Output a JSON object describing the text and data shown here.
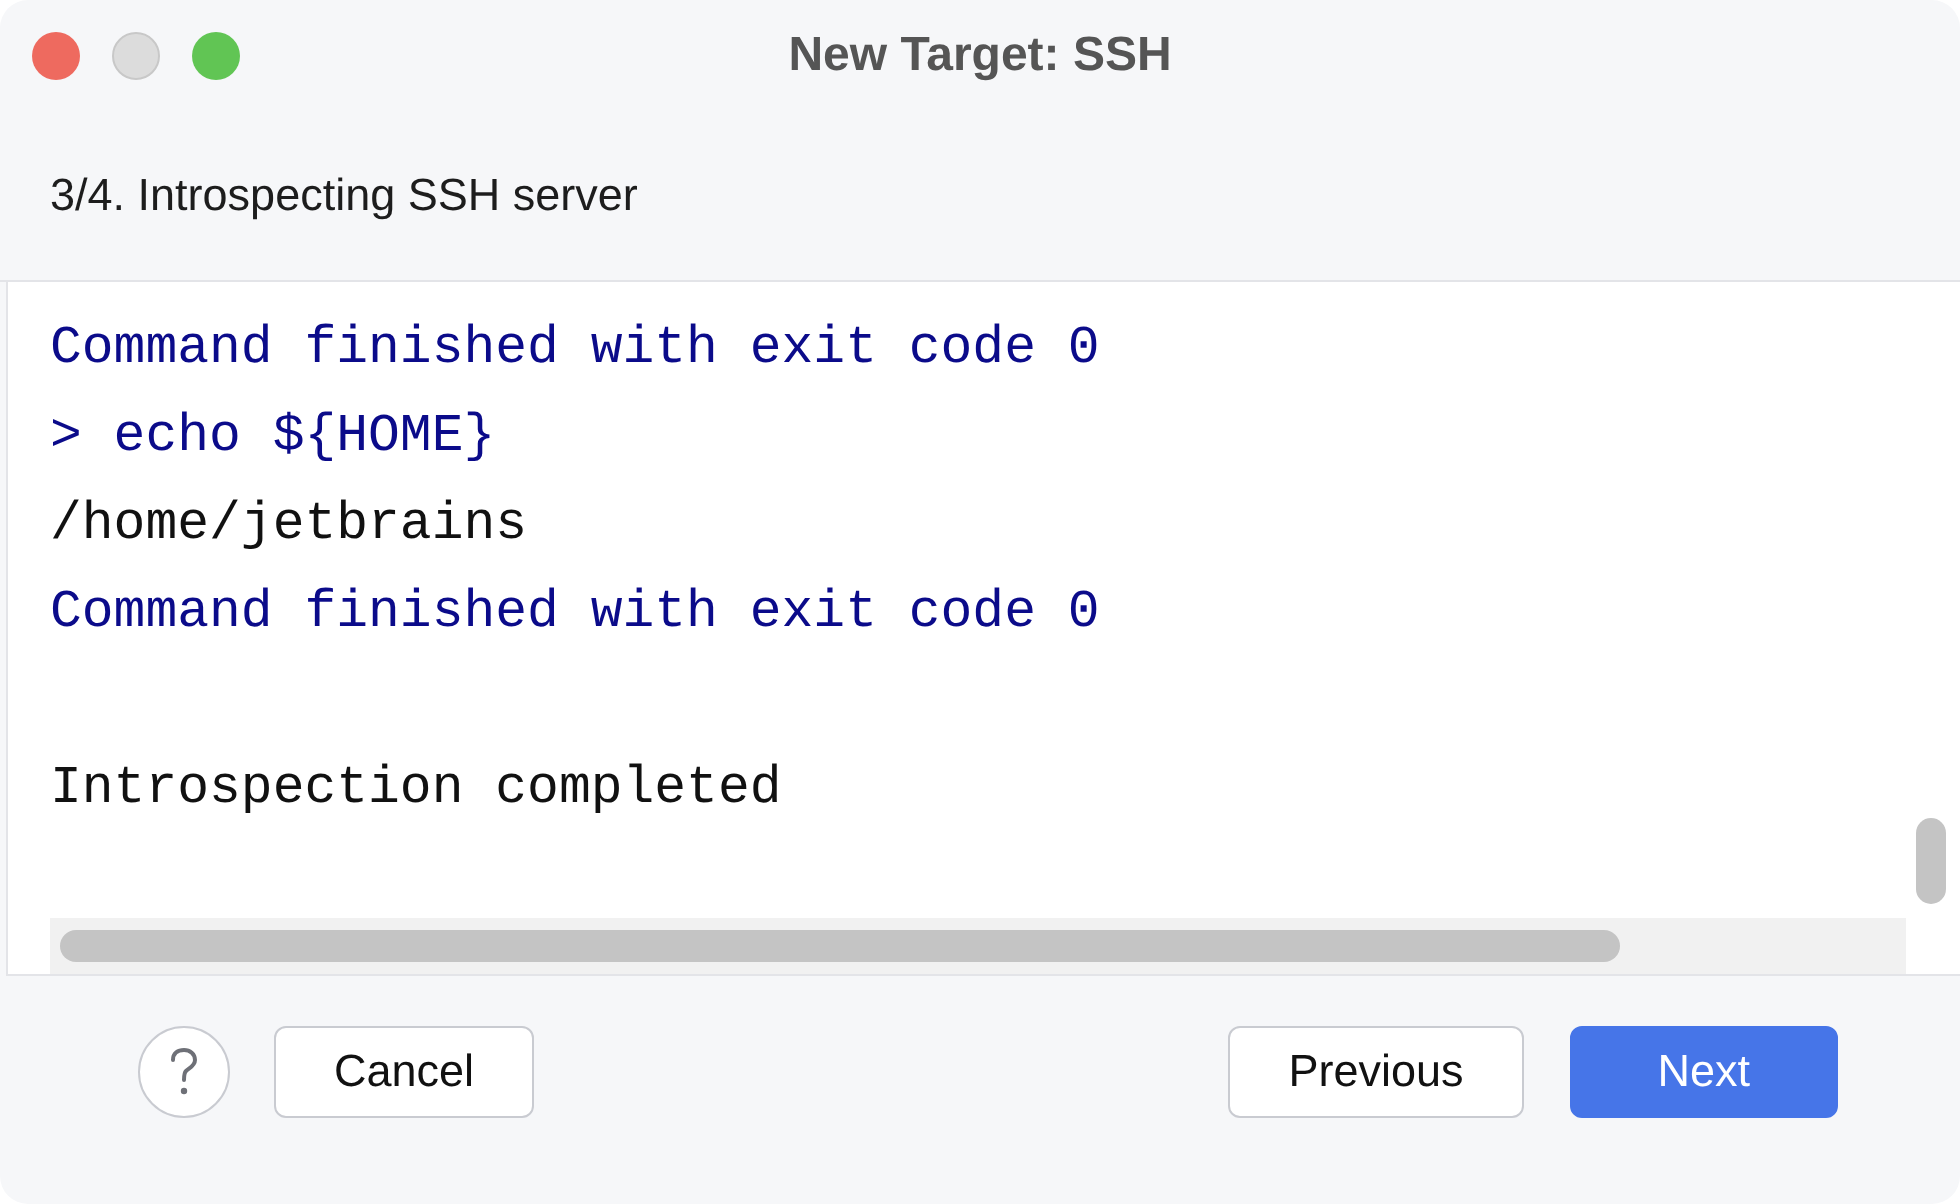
{
  "window": {
    "title": "New Target: SSH",
    "controls": [
      {
        "kind": "close",
        "disabled": false
      },
      {
        "kind": "minimize",
        "disabled": true
      },
      {
        "kind": "zoom",
        "disabled": false
      }
    ]
  },
  "step": {
    "title": "3/4. Introspecting SSH server"
  },
  "console": {
    "lines": [
      {
        "kind": "status",
        "text": "Command finished with exit code 0"
      },
      {
        "kind": "command",
        "text": "> echo ${HOME}"
      },
      {
        "kind": "output",
        "text": "/home/jetbrains"
      },
      {
        "kind": "status",
        "text": "Command finished with exit code 0"
      },
      {
        "kind": "blank"
      },
      {
        "kind": "output",
        "text": "Introspection completed"
      }
    ]
  },
  "buttons": [
    {
      "label": "Cancel",
      "kind": "secondary"
    },
    {
      "label": "Previous",
      "kind": "secondary"
    },
    {
      "label": "Next",
      "kind": "primary"
    }
  ]
}
